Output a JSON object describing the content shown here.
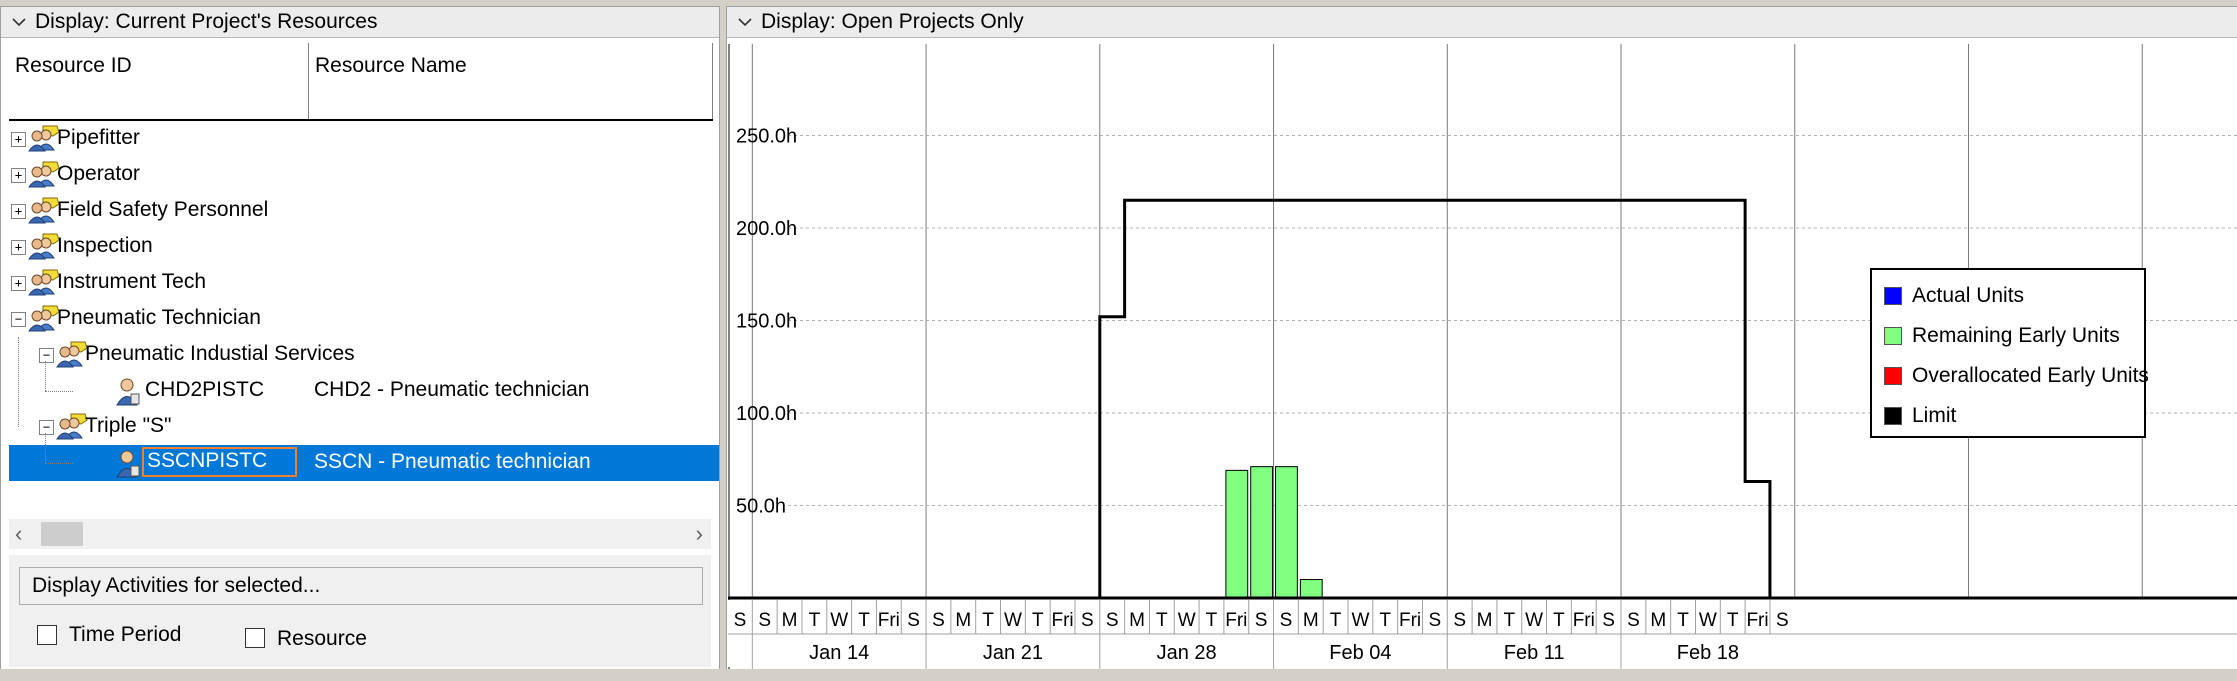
{
  "left_panel": {
    "header": "Display: Current Project's Resources",
    "columns": [
      "Resource ID",
      "Resource Name"
    ],
    "rows": [
      {
        "id": "Pipefitter",
        "name": "",
        "toggle": "+"
      },
      {
        "id": "Operator",
        "name": "",
        "toggle": "+"
      },
      {
        "id": "Field Safety Personnel",
        "name": "",
        "toggle": "+"
      },
      {
        "id": "Inspection",
        "name": "",
        "toggle": "+"
      },
      {
        "id": "Instrument Tech",
        "name": "",
        "toggle": "+"
      },
      {
        "id": "Pneumatic Technician",
        "name": "",
        "toggle": "−"
      },
      {
        "id": "Pneumatic Industial Services",
        "name": "",
        "toggle": "−"
      },
      {
        "id": "CHD2PISTC",
        "name": "CHD2 - Pneumatic technician",
        "toggle": ""
      },
      {
        "id": "Triple \"S\"",
        "name": "",
        "toggle": "−"
      },
      {
        "id": "SSCNPISTC",
        "name": "SSCN - Pneumatic technician",
        "toggle": "",
        "selected": true
      }
    ],
    "display_activities_label": "Display Activities for selected...",
    "checkboxes": [
      {
        "label": "Time Period",
        "checked": false
      },
      {
        "label": "Resource",
        "checked": false
      }
    ]
  },
  "right_panel": {
    "header": "Display: Open Projects Only"
  },
  "chart_data": {
    "type": "bar",
    "y_ticks": [
      "50.0h",
      "100.0h",
      "150.0h",
      "200.0h",
      "250.0h"
    ],
    "ylim": [
      0,
      300
    ],
    "day_letters": [
      "S",
      "S",
      "M",
      "T",
      "W",
      "T",
      "Fri",
      "S",
      "S",
      "M",
      "T",
      "W",
      "T",
      "Fri",
      "S",
      "S",
      "M",
      "T",
      "W",
      "T",
      "Fri",
      "S",
      "S",
      "M",
      "T",
      "W",
      "T",
      "Fri",
      "S",
      "S",
      "M",
      "T",
      "W",
      "T",
      "Fri",
      "S",
      "S",
      "M",
      "T",
      "W",
      "T",
      "Fri",
      "S"
    ],
    "week_labels": [
      "Jan 14",
      "Jan 21",
      "Jan 28",
      "Feb 04",
      "Feb 11",
      "Feb 18"
    ],
    "series": [
      {
        "name": "Remaining Early Units",
        "color": "#80ff80",
        "points": [
          {
            "day_index": 20,
            "value": 69
          },
          {
            "day_index": 21,
            "value": 71
          },
          {
            "day_index": 22,
            "value": 71
          },
          {
            "day_index": 23,
            "value": 10
          }
        ]
      },
      {
        "name": "Limit",
        "color": "#000000",
        "steps": [
          {
            "from_day": 0,
            "value": 0
          },
          {
            "from_day": 15,
            "value": 152
          },
          {
            "from_day": 16,
            "value": 215
          },
          {
            "from_day": 41,
            "value": 63
          },
          {
            "from_day": 42,
            "value": 0
          }
        ]
      }
    ],
    "legend": [
      {
        "label": "Actual Units",
        "color": "#0000ff"
      },
      {
        "label": "Remaining Early Units",
        "color": "#80ff80"
      },
      {
        "label": "Overallocated Early Units",
        "color": "#ff0000"
      },
      {
        "label": "Limit",
        "color": "#000000"
      }
    ]
  }
}
